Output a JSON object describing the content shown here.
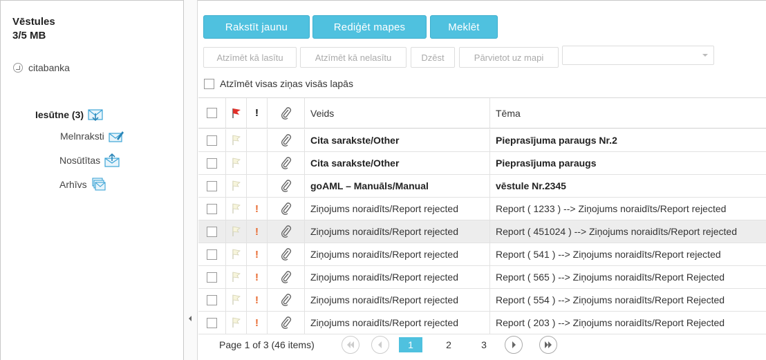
{
  "sidebar": {
    "title": "Vēstules",
    "quota": "3/5 MB",
    "account": "citabanka",
    "folders": {
      "inbox": "Iesūtne (3)",
      "drafts": "Melnraksti",
      "sent": "Nosūtītas",
      "archive": "Arhīvs"
    }
  },
  "toolbar": {
    "compose": "Rakstīt jaunu",
    "edit_folders": "Rediģēt mapes",
    "search": "Meklēt",
    "mark_read": "Atzīmēt kā lasītu",
    "mark_unread": "Atzīmēt kā nelasītu",
    "delete": "Dzēst",
    "move": "Pārvietot uz mapi",
    "move_select_value": "",
    "select_all": "Atzīmēt visas ziņas visās lapās"
  },
  "table": {
    "columns": {
      "type": "Veids",
      "subject": "Tēma"
    },
    "rows": [
      {
        "type": "Cita sarakste/Other",
        "subject": "Pieprasījuma paraugs Nr.2",
        "unread": true,
        "priority": false
      },
      {
        "type": "Cita sarakste/Other",
        "subject": "Pieprasījuma paraugs",
        "unread": true,
        "priority": false
      },
      {
        "type": "goAML – Manuāls/Manual",
        "subject": "vēstule Nr.2345",
        "unread": true,
        "priority": false
      },
      {
        "type": "Ziņojums noraidīts/Report rejected",
        "subject": "Report ( 1233 ) --> Ziņojums noraidīts/Report rejected",
        "unread": false,
        "priority": true
      },
      {
        "type": "Ziņojums noraidīts/Report rejected",
        "subject": "Report ( 451024 ) --> Ziņojums noraidīts/Report rejected",
        "unread": false,
        "priority": true,
        "selected": true
      },
      {
        "type": "Ziņojums noraidīts/Report rejected",
        "subject": "Report ( 541 ) --> Ziņojums noraidīts/Report rejected",
        "unread": false,
        "priority": true
      },
      {
        "type": "Ziņojums noraidīts/Report rejected",
        "subject": "Report ( 565 ) --> Ziņojums noraidīts/Report Rejected",
        "unread": false,
        "priority": true
      },
      {
        "type": "Ziņojums noraidīts/Report rejected",
        "subject": "Report ( 554 ) --> Ziņojums noraidīts/Report Rejected",
        "unread": false,
        "priority": true
      },
      {
        "type": "Ziņojums noraidīts/Report rejected",
        "subject": "Report ( 203 ) --> Ziņojums noraidīts/Report Rejected",
        "unread": false,
        "priority": true
      }
    ]
  },
  "pager": {
    "info": "Page 1 of 3 (46 items)",
    "pages": [
      "1",
      "2",
      "3"
    ],
    "current_page": "1"
  },
  "colors": {
    "accent": "#4fc1df",
    "priority": "#e8692f",
    "selected_row": "#ededed",
    "icon_blue": "#3ba3d6"
  }
}
